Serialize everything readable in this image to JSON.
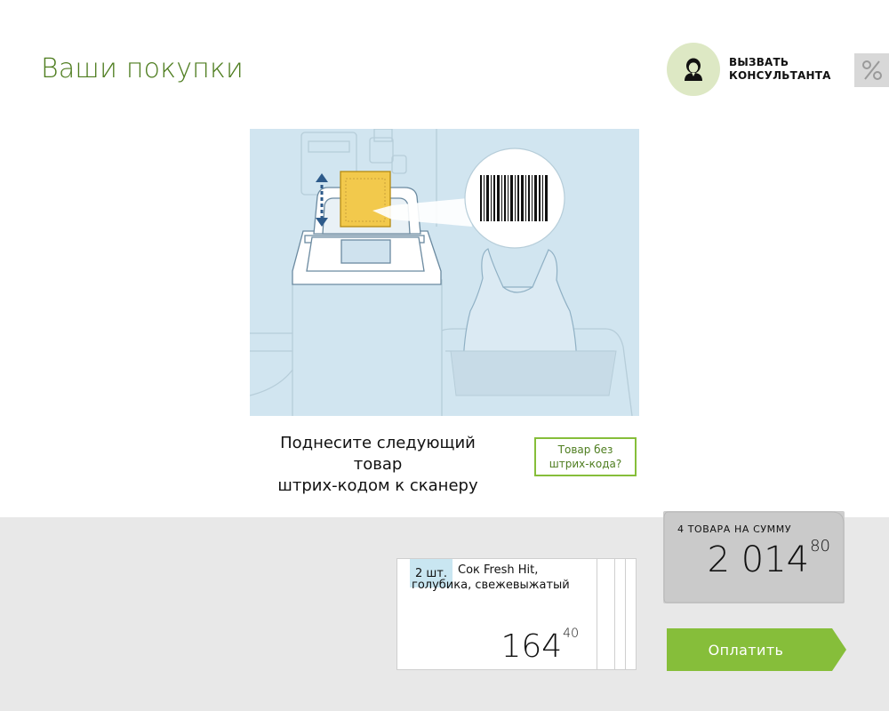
{
  "header": {
    "title": "Ваши покупки",
    "consultant_label_line1": "ВЫЗВАТЬ",
    "consultant_label_line2": "КОНСУЛЬТАНТА",
    "discount_symbol": "%"
  },
  "scan": {
    "instruction_line1": "Поднесите следующий товар",
    "instruction_line2": "штрих-кодом к сканеру",
    "no_barcode_line1": "Товар без",
    "no_barcode_line2": "штрих-кода?"
  },
  "last_item": {
    "qty": "2 шт.",
    "name": "Сок Fresh Hit, голубика, свежевыжатый",
    "price_main": "164",
    "price_cents": "40"
  },
  "total": {
    "label": "4 ТОВАРА НА СУММУ",
    "amount_main": "2 014",
    "amount_cents": "80"
  },
  "actions": {
    "pay_label": "Оплатить"
  },
  "colors": {
    "accent_green": "#86be3a",
    "title_green": "#4e7d1f",
    "illustration_bg": "#d1e5f0",
    "card_yellow": "#f2c94c"
  },
  "icons": {
    "consultant": "person-headset-icon",
    "discount": "percent-icon",
    "scan_up_down": "vertical-arrows-icon",
    "barcode": "barcode-icon"
  }
}
